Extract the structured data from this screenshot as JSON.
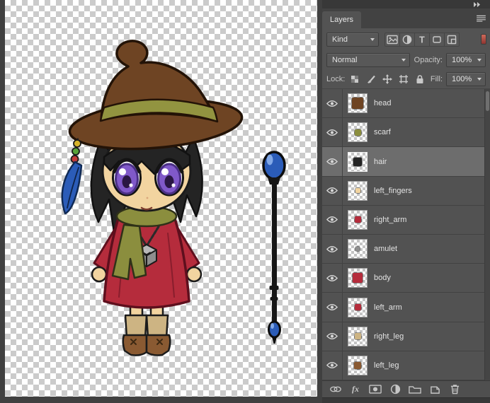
{
  "panel": {
    "tab_label": "Layers",
    "filter": {
      "kind_value": "Kind",
      "buttons": [
        "pixel-layers-filter",
        "adjustment-layers-filter",
        "type-layers-filter",
        "shape-layers-filter",
        "smart-objects-filter"
      ],
      "toggle": "layer-filtering-toggle"
    },
    "blend": {
      "mode_value": "Normal",
      "opacity_label": "Opacity:",
      "opacity_value": "100%"
    },
    "lock": {
      "label": "Lock:",
      "buttons": [
        "lock-transparent-pixels",
        "lock-image-pixels",
        "lock-position",
        "lock-artboards",
        "lock-all"
      ],
      "fill_label": "Fill:",
      "fill_value": "100%"
    },
    "footer": {
      "fx_label": "fx",
      "buttons": [
        "link-layers",
        "layer-styles",
        "add-layer-mask",
        "new-fill-adjustment-layer",
        "new-group",
        "new-layer",
        "delete-layer"
      ]
    },
    "window": {
      "collapse_icon": "double-arrow-right",
      "menu_icon": "panel-menu"
    }
  },
  "layers": {
    "items": [
      {
        "name": "head",
        "visible": true,
        "selected": false,
        "thumb_color": "#6e4423",
        "thumb_size": 16
      },
      {
        "name": "scarf",
        "visible": true,
        "selected": false,
        "thumb_color": "#8b8e3e",
        "thumb_size": 9
      },
      {
        "name": "hair",
        "visible": true,
        "selected": true,
        "thumb_color": "#242424",
        "thumb_size": 12
      },
      {
        "name": "left_fingers",
        "visible": true,
        "selected": false,
        "thumb_color": "#f2d4a0",
        "thumb_size": 7
      },
      {
        "name": "right_arm",
        "visible": true,
        "selected": false,
        "thumb_color": "#b52c3c",
        "thumb_size": 9
      },
      {
        "name": "amulet",
        "visible": true,
        "selected": false,
        "thumb_color": "#8e8e8e",
        "thumb_size": 6
      },
      {
        "name": "body",
        "visible": true,
        "selected": false,
        "thumb_color": "#b52c3c",
        "thumb_size": 14
      },
      {
        "name": "left_arm",
        "visible": true,
        "selected": false,
        "thumb_color": "#b52c3c",
        "thumb_size": 9
      },
      {
        "name": "right_leg",
        "visible": true,
        "selected": false,
        "thumb_color": "#cdb483",
        "thumb_size": 9
      },
      {
        "name": "left_leg",
        "visible": true,
        "selected": false,
        "thumb_color": "#8a5a32",
        "thumb_size": 10
      }
    ]
  },
  "artwork": {
    "colors": {
      "hat": "#6e4423",
      "hatband": "#929440",
      "hair": "#242424",
      "skin": "#f2d4a0",
      "eye": "#8059c9",
      "eyedark": "#4a2f85",
      "dress": "#b52c3c",
      "dressline": "#5e0f1d",
      "scarf": "#8b8e3e",
      "boot": "#8a5a32",
      "sock": "#cdb483",
      "staffblue": "#2b5cb8",
      "amulet": "#8e8e8e",
      "beadyellow": "#d6b32c",
      "beadgreen": "#57a23a",
      "beadred": "#c23b3b"
    }
  }
}
